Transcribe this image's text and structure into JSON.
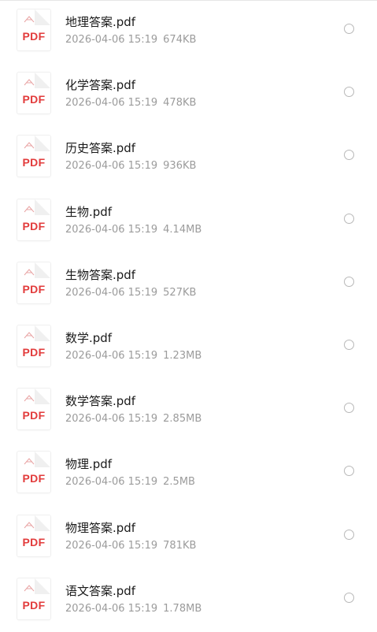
{
  "icon_label": "PDF",
  "icon_semantic": "pdf-file-icon",
  "files": [
    {
      "name": "地理答案.pdf",
      "date": "2026-04-06 15:19",
      "size": "674KB"
    },
    {
      "name": "化学答案.pdf",
      "date": "2026-04-06 15:19",
      "size": "478KB"
    },
    {
      "name": "历史答案.pdf",
      "date": "2026-04-06 15:19",
      "size": "936KB"
    },
    {
      "name": "生物.pdf",
      "date": "2026-04-06 15:19",
      "size": "4.14MB"
    },
    {
      "name": "生物答案.pdf",
      "date": "2026-04-06 15:19",
      "size": "527KB"
    },
    {
      "name": "数学.pdf",
      "date": "2026-04-06 15:19",
      "size": "1.23MB"
    },
    {
      "name": "数学答案.pdf",
      "date": "2026-04-06 15:19",
      "size": "2.85MB"
    },
    {
      "name": "物理.pdf",
      "date": "2026-04-06 15:19",
      "size": "2.5MB"
    },
    {
      "name": "物理答案.pdf",
      "date": "2026-04-06 15:19",
      "size": "781KB"
    },
    {
      "name": "语文答案.pdf",
      "date": "2026-04-06 15:19",
      "size": "1.78MB"
    }
  ],
  "colors": {
    "pdf_red": "#e23b3b",
    "meta_gray": "#9b9b9b",
    "radio_border": "#b8b8b8"
  }
}
